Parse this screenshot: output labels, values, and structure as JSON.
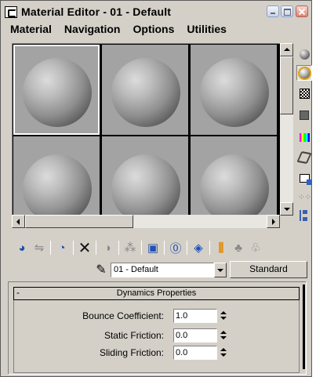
{
  "window": {
    "title": "Material Editor - 01 - Default",
    "title_icon": "material-editor-icon",
    "controls": [
      "minimize-icon",
      "maximize-icon",
      "close-icon"
    ]
  },
  "menu": {
    "items": [
      "Material",
      "Navigation",
      "Options",
      "Utilities"
    ]
  },
  "sample_slots": {
    "count": 6,
    "active_index": 0,
    "background_color": "#a3a3a3"
  },
  "right_toolbar": {
    "items": [
      {
        "icon": "sample-type-sphere-icon"
      },
      {
        "icon": "backlight-icon"
      },
      {
        "icon": "background-checker-icon"
      },
      {
        "icon": "sample-uv-tiling-icon"
      },
      {
        "icon": "video-color-check-icon"
      },
      {
        "icon": "make-preview-icon"
      },
      {
        "icon": "options-icon"
      },
      {
        "icon": "select-by-material-icon"
      },
      {
        "icon": "material-map-navigator-icon"
      }
    ]
  },
  "bottom_toolbar": {
    "items": [
      {
        "icon": "get-material-icon"
      },
      {
        "icon": "put-material-to-scene-icon"
      },
      {
        "icon": "assign-material-to-selection-icon"
      },
      {
        "icon": "reset-map-icon"
      },
      {
        "icon": "make-material-copy-icon"
      },
      {
        "icon": "make-unique-icon"
      },
      {
        "icon": "put-to-library-icon"
      },
      {
        "icon": "material-id-channel-icon"
      },
      {
        "icon": "show-map-in-viewport-icon"
      },
      {
        "icon": "show-end-result-icon"
      },
      {
        "icon": "go-to-parent-icon"
      },
      {
        "icon": "go-forward-to-sibling-icon"
      }
    ]
  },
  "material": {
    "name": "01 - Default",
    "type": "Standard",
    "eyedropper_icon": "pick-material-from-object-icon"
  },
  "rollout": {
    "collapse_symbol": "-",
    "title": "Dynamics Properties",
    "params": [
      {
        "label": "Bounce Coefficient:",
        "value": "1.0"
      },
      {
        "label": "Static Friction:",
        "value": "0.0"
      },
      {
        "label": "Sliding Friction:",
        "value": "0.0"
      }
    ]
  }
}
